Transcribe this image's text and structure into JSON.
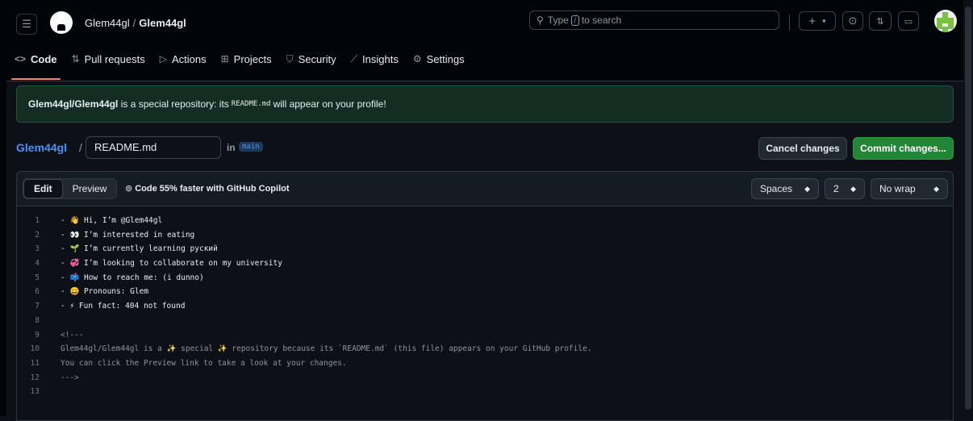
{
  "header": {
    "owner": "Glem44gl",
    "separator": "/",
    "repo": "Glem44gl",
    "search_placeholder_prefix": "Type",
    "search_key": "/",
    "search_placeholder_suffix": "to search",
    "plus_label": "+",
    "caret": "▾"
  },
  "nav": {
    "tabs": [
      {
        "label": "Code",
        "icon": "code-icon",
        "glyph": "<>"
      },
      {
        "label": "Pull requests",
        "icon": "pull-request-icon",
        "glyph": "⇅"
      },
      {
        "label": "Actions",
        "icon": "play-icon",
        "glyph": "▷"
      },
      {
        "label": "Projects",
        "icon": "table-icon",
        "glyph": "⊞"
      },
      {
        "label": "Security",
        "icon": "shield-icon",
        "glyph": "⛉"
      },
      {
        "label": "Insights",
        "icon": "graph-icon",
        "glyph": "⟋"
      },
      {
        "label": "Settings",
        "icon": "gear-icon",
        "glyph": "⚙"
      }
    ]
  },
  "banner": {
    "repo": "Glem44gl/Glem44gl",
    "text1": "is a special repository: its",
    "file": "README.md",
    "text2": "will appear on your profile!"
  },
  "filebar": {
    "repo": "Glem44gl",
    "slash": "/",
    "filename": "README.md",
    "in": "in",
    "branch": "main",
    "cancel": "Cancel changes",
    "commit": "Commit changes..."
  },
  "editor": {
    "edit": "Edit",
    "preview": "Preview",
    "copilot": "Code 55% faster with GitHub Copilot",
    "indent_mode": "Spaces",
    "indent_size": "2",
    "wrap_mode": "No wrap",
    "lines": [
      {
        "n": "1",
        "text": "- 👋 Hi, I’m @Glem44gl"
      },
      {
        "n": "2",
        "text": "- 👀 I’m interested in eating"
      },
      {
        "n": "3",
        "text": "- 🌱 I’m currently learning руский"
      },
      {
        "n": "4",
        "text": "- 💞️ I’m looking to collaborate on my university"
      },
      {
        "n": "5",
        "text": "- 📫 How to reach me: (i dunno)"
      },
      {
        "n": "6",
        "text": "- 😄 Pronouns: Glem"
      },
      {
        "n": "7",
        "text": "- ⚡ Fun fact: 404 not found"
      },
      {
        "n": "8",
        "text": ""
      },
      {
        "n": "9",
        "text": "<!---"
      },
      {
        "n": "10",
        "text": "Glem44gl/Glem44gl is a ✨ special ✨ repository because its `README.md` (this file) appears on your GitHub profile."
      },
      {
        "n": "11",
        "text": "You can click the Preview link to take a look at your changes."
      },
      {
        "n": "12",
        "text": "--->"
      },
      {
        "n": "13",
        "text": ""
      }
    ]
  },
  "colors": {
    "accent_underline": "#f78166",
    "commit_green": "#238636",
    "link_blue": "#4493f8",
    "banner_bg": "#132d23"
  }
}
